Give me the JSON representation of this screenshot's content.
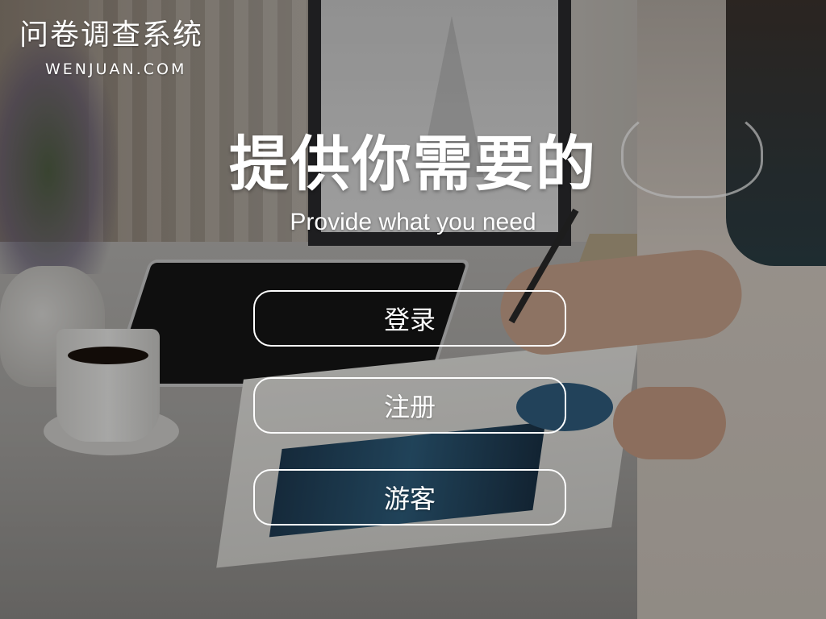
{
  "brand": {
    "name_cn": "问卷调查系统",
    "domain": "WENJUAN.COM"
  },
  "hero": {
    "title": "提供你需要的",
    "subtitle": "Provide what you need"
  },
  "actions": {
    "login": "登录",
    "register": "注册",
    "guest": "游客"
  },
  "colors": {
    "text": "#ffffff",
    "button_border": "#ffffff",
    "overlay": "rgba(0,0,0,0.30)"
  }
}
